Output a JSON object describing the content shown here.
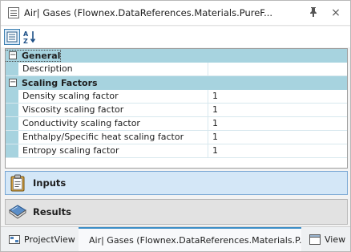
{
  "window": {
    "title": "Air| Gases (Flownex.DataReferences.Materials.PureF...",
    "pin_icon": "pin-icon",
    "close_icon": "close-icon"
  },
  "toolbar": {
    "categorized_icon": "categorized-view-icon",
    "sort_icon": "sort-alphabetical-icon"
  },
  "property_grid": {
    "categories": [
      {
        "name": "General",
        "expanded": true,
        "properties": [
          {
            "name": "Description",
            "value": ""
          }
        ]
      },
      {
        "name": "Scaling Factors",
        "expanded": true,
        "properties": [
          {
            "name": "Density scaling factor",
            "value": "1"
          },
          {
            "name": "Viscosity scaling factor",
            "value": "1"
          },
          {
            "name": "Conductivity scaling factor",
            "value": "1"
          },
          {
            "name": "Enthalpy/Specific heat scaling factor",
            "value": "1"
          },
          {
            "name": "Entropy scaling factor",
            "value": "1"
          }
        ]
      }
    ]
  },
  "panels": {
    "inputs": {
      "label": "Inputs",
      "icon": "clipboard-icon"
    },
    "results": {
      "label": "Results",
      "icon": "book-icon"
    }
  },
  "tabs": [
    {
      "label": "ProjectView",
      "icon": "project-view-icon",
      "active": false
    },
    {
      "label": "Air| Gases (Flownex.DataReferences.Materials.P...",
      "icon": "document-icon",
      "active": true
    },
    {
      "label": "View",
      "icon": "view-icon",
      "active": false
    }
  ],
  "colors": {
    "category_row": "#a7d3df",
    "inputs_panel": "#d4e7f7",
    "results_panel": "#e2e2e2",
    "active_tab_accent": "#3c8dc6"
  }
}
